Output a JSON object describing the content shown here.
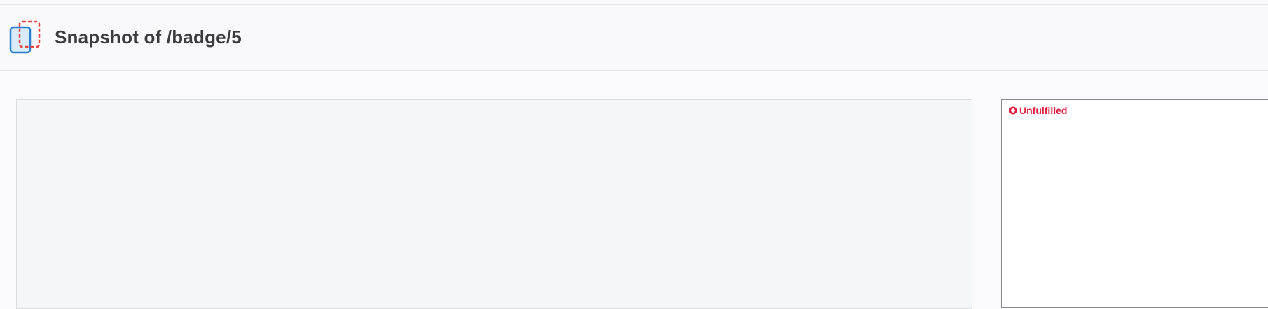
{
  "header": {
    "title": "Snapshot of /badge/5",
    "logo_icon": "snapshot-compare-icon"
  },
  "preview": {
    "state": "empty"
  },
  "status": {
    "label": "Unfulfilled",
    "icon": "ring-icon",
    "color": "#e11d3f"
  },
  "colors": {
    "accent_blue": "#2b7fd0",
    "accent_red": "#e8453c"
  }
}
